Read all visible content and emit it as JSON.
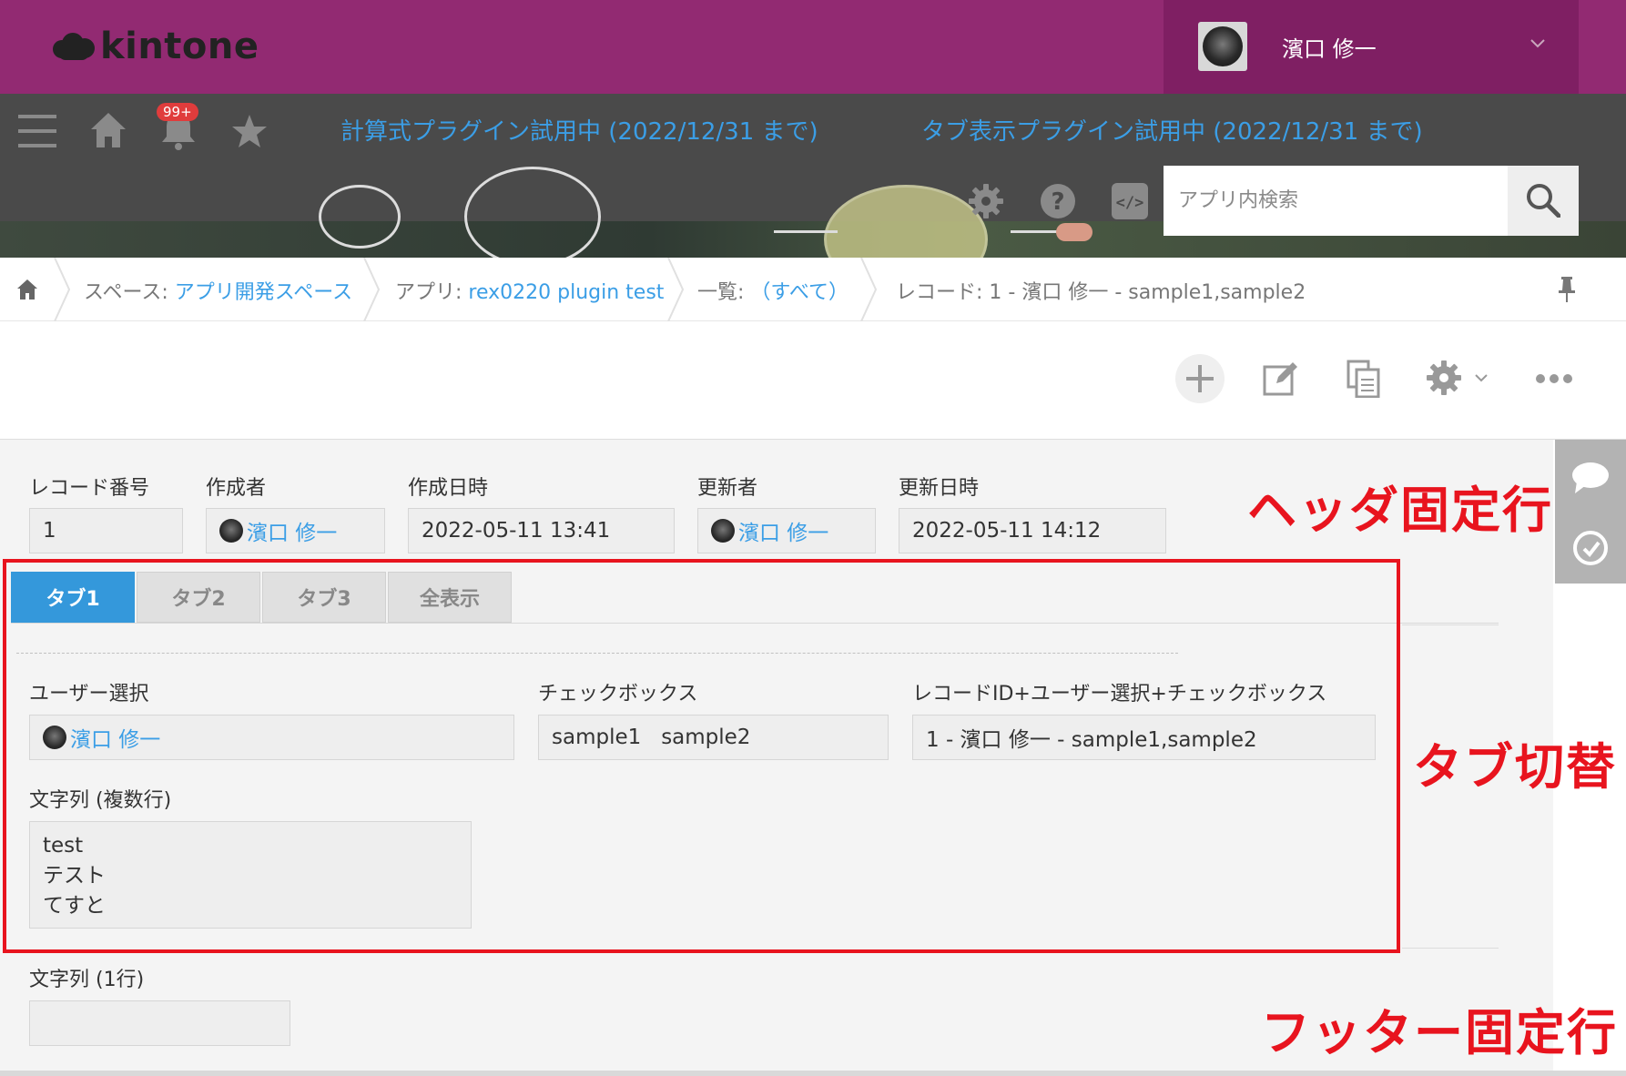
{
  "header": {
    "logo_text": "kintone",
    "user_name": "濱口 修一"
  },
  "toolbar": {
    "notification_badge": "99+",
    "plugin_links": [
      "計算式プラグイン試用中 (2022/12/31 まで)",
      "タブ表示プラグイン試用中 (2022/12/31 まで)"
    ],
    "search_placeholder": "アプリ内検索"
  },
  "breadcrumb": {
    "space_prefix": "スペース: ",
    "space_name": "アプリ開発スペース",
    "app_prefix": "アプリ: ",
    "app_name": "rex0220 plugin test",
    "view_prefix": "一覧: ",
    "view_name": "（すべて）",
    "record_label": "レコード: 1 - 濱口 修一 - sample1,sample2"
  },
  "record_header": {
    "record_number_label": "レコード番号",
    "record_number_value": "1",
    "creator_label": "作成者",
    "creator_value": "濱口 修一",
    "created_at_label": "作成日時",
    "created_at_value": "2022-05-11 13:41",
    "updater_label": "更新者",
    "updater_value": "濱口 修一",
    "updated_at_label": "更新日時",
    "updated_at_value": "2022-05-11 14:12"
  },
  "tabs": [
    {
      "label": "タブ1",
      "active": true
    },
    {
      "label": "タブ2",
      "active": false
    },
    {
      "label": "タブ3",
      "active": false
    },
    {
      "label": "全表示",
      "active": false
    }
  ],
  "tab_content": {
    "user_select_label": "ユーザー選択",
    "user_select_value": "濱口 修一",
    "checkbox_label": "チェックボックス",
    "checkbox_value": "sample1   sample2",
    "combined_label": "レコードID+ユーザー選択+チェックボックス",
    "combined_value": "1 - 濱口 修一 - sample1,sample2",
    "multiline_label": "文字列 (複数行)",
    "multiline_value": "test\nテスト\nてすと"
  },
  "footer_fields": {
    "single_line_label": "文字列 (1行)",
    "single_line_value": ""
  },
  "annotations": {
    "header_fixed": "ヘッダ固定行",
    "tab_switch": "タブ切替",
    "footer_fixed": "フッター固定行"
  },
  "colors": {
    "header_purple": "#922a72",
    "toolbar_dark": "#4a4a4a",
    "link_blue": "#3b9ee6",
    "tab_active": "#3498db",
    "annotation_red": "#e8141e"
  }
}
